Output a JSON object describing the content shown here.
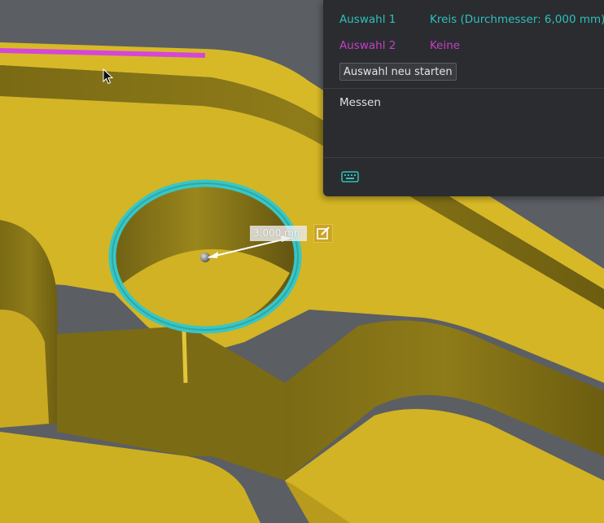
{
  "selection": {
    "first_label": "Auswahl 1",
    "first_value": "Kreis (Durchmesser: 6,000 mm)",
    "second_label": "Auswahl 2",
    "second_value": "Keine",
    "restart_label": "Auswahl neu starten"
  },
  "measure": {
    "label": "Messen",
    "keyboard_icon": "keyboard-icon"
  },
  "dimension": {
    "value_label": "3,000 mm",
    "edit_icon": "edit-icon"
  },
  "colors": {
    "accent_first": "#2ec0bf",
    "accent_second": "#c43ec9",
    "model_yellow": "#d4b624",
    "panel_bg": "#2b2c2f"
  }
}
